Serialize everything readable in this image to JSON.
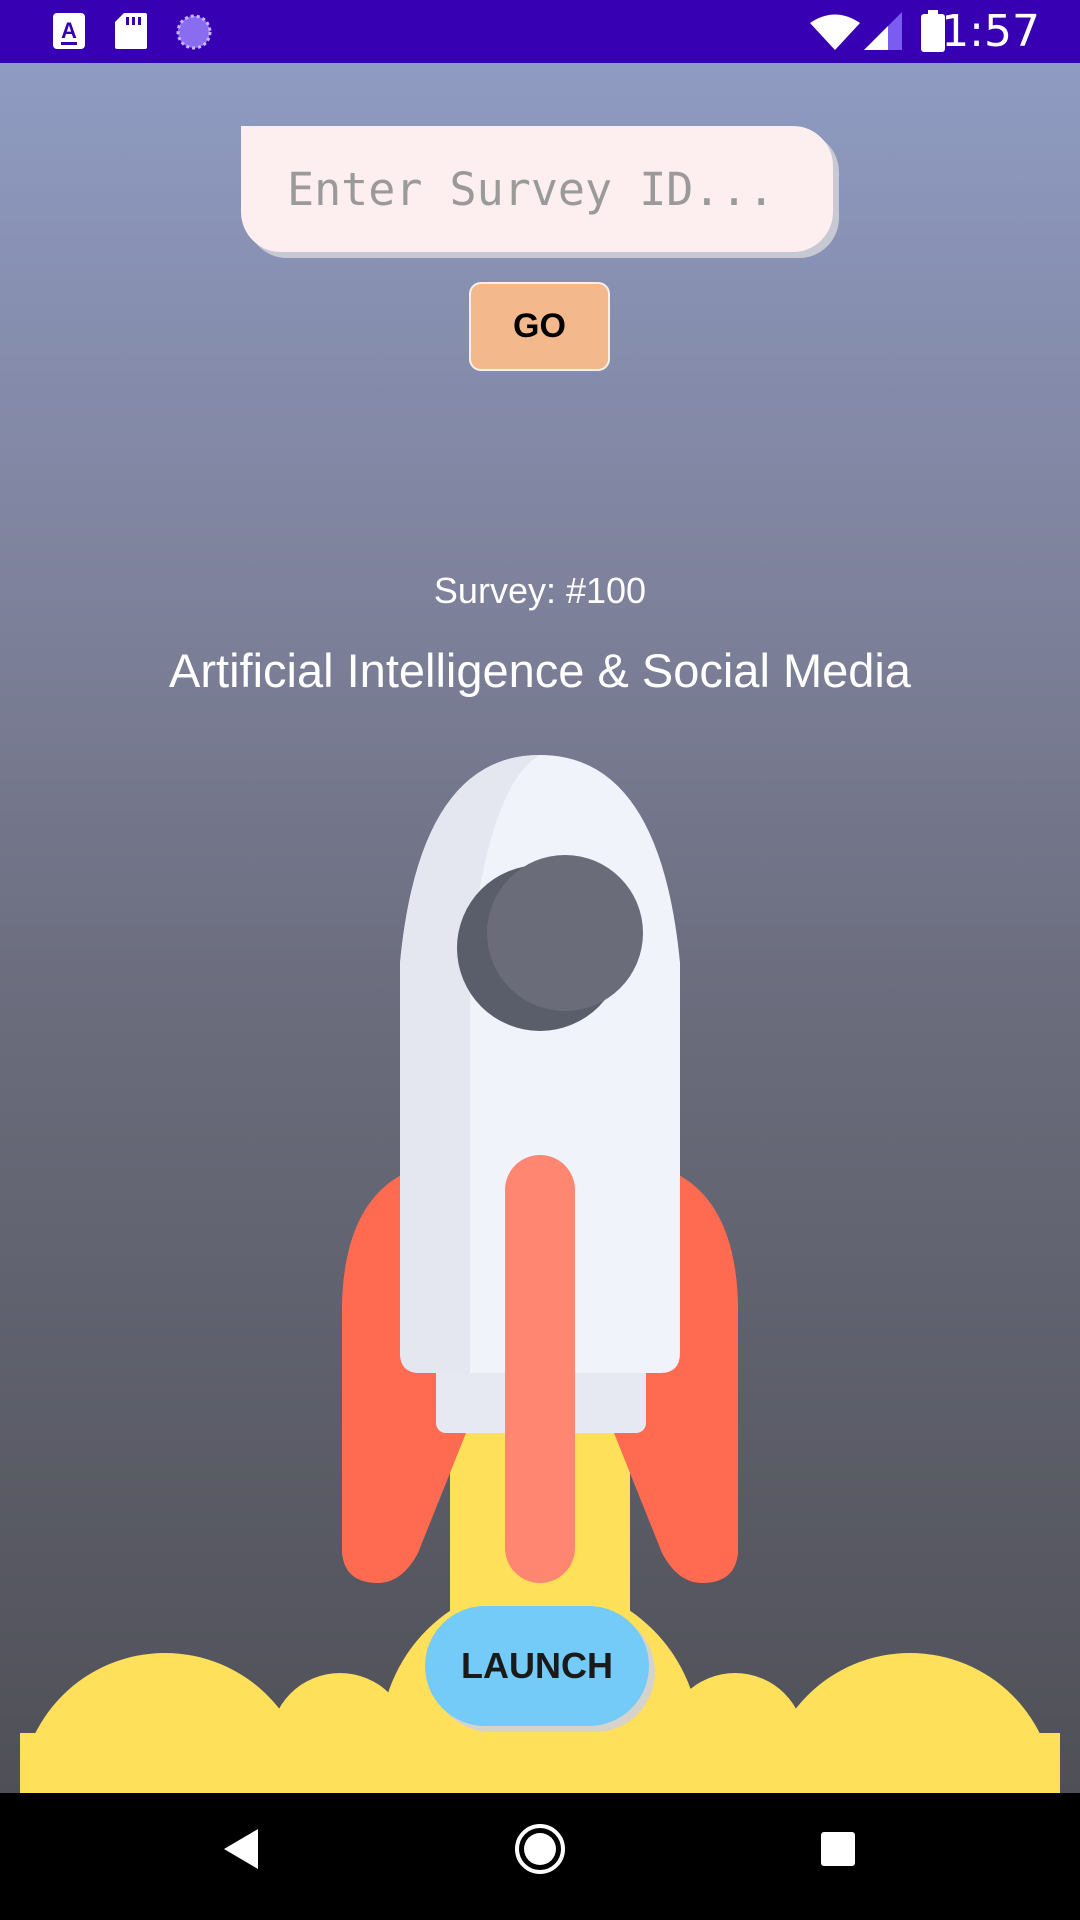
{
  "status_bar": {
    "time": "1:57",
    "color": "#3700B3",
    "left_icons": [
      "a-accessibility-icon",
      "sd-card-icon",
      "loading-circle-icon"
    ],
    "right_icons": [
      "wifi-icon",
      "signal-icon",
      "battery-icon"
    ]
  },
  "survey_search": {
    "placeholder": "Enter Survey ID...",
    "value": "",
    "go_label": "GO"
  },
  "survey": {
    "number_label": "Survey: #100",
    "title": "Artificial Intelligence & Social Media"
  },
  "illustration": {
    "icon": "rocket-launch-icon"
  },
  "launch": {
    "label": "LAUNCH",
    "color": "#74cbf7"
  },
  "nav_bar": {
    "buttons": [
      "back-icon",
      "home-icon",
      "recents-icon"
    ]
  },
  "colors": {
    "go_button": "#f3b88c",
    "input_background": "#fdeef0",
    "flame": "#ffe05a",
    "fins": "#ff6b50"
  }
}
